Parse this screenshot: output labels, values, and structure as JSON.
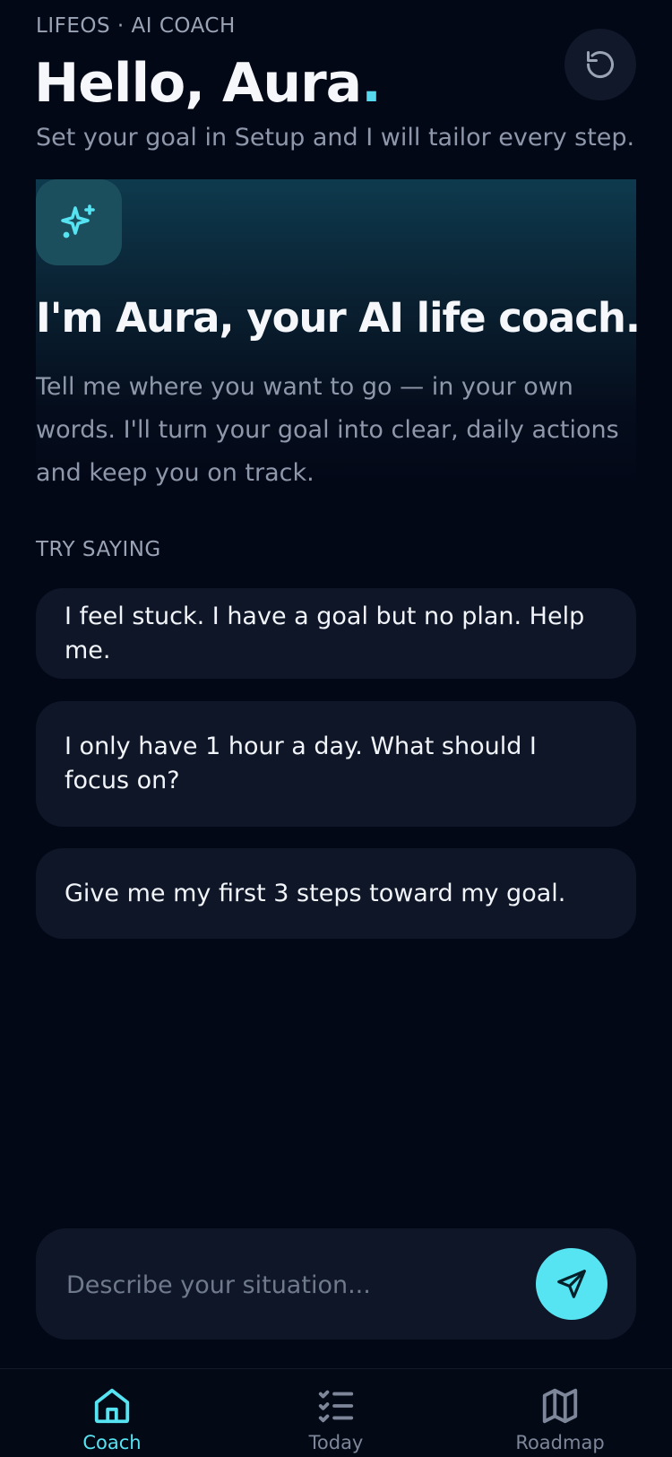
{
  "header": {
    "eyebrow": "LIFEOS · AI COACH",
    "title": "Hello, Aura",
    "title_dot": ".",
    "subtitle": "Set your goal in Setup and I will tailor every step."
  },
  "hero": {
    "icon": "sparkles-icon",
    "title": "I'm Aura, your AI life coach.",
    "body": "Tell me where you want to go — in your own words. I'll turn your goal into clear, daily actions and keep you on track."
  },
  "suggestions": {
    "label": "TRY SAYING",
    "items": [
      "I feel stuck. I have a goal but no plan. Help me.",
      "I only have 1 hour a day. What should I focus on?",
      "Give me my first 3 steps toward my goal."
    ]
  },
  "composer": {
    "placeholder": "Describe your situation...",
    "send_icon": "send-icon"
  },
  "nav": {
    "items": [
      {
        "label": "Coach",
        "icon": "home-icon",
        "active": true
      },
      {
        "label": "Today",
        "icon": "checklist-icon",
        "active": false
      },
      {
        "label": "Roadmap",
        "icon": "map-icon",
        "active": false
      }
    ]
  },
  "colors": {
    "background": "#030817",
    "accent": "#56e4f2",
    "card": "#0f1628",
    "muted_text": "#8e98aa"
  }
}
